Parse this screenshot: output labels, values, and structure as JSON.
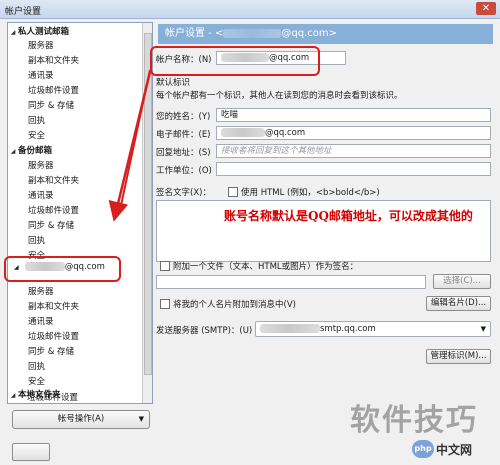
{
  "window": {
    "title": "帐户设置",
    "close_glyph": "✕"
  },
  "tree": {
    "group1": "私人测试邮箱",
    "group1_items": [
      "服务器",
      "副本和文件夹",
      "通讯录",
      "垃圾邮件设置",
      "同步 & 存储",
      "回执",
      "安全"
    ],
    "group2": "备份邮箱",
    "group2_items": [
      "服务器",
      "副本和文件夹",
      "通讯录",
      "垃圾邮件设置",
      "同步 & 存储",
      "回执",
      "安全"
    ],
    "selected_account_suffix": "@qq.com",
    "account_items": [
      "服务器",
      "副本和文件夹",
      "通讯录",
      "垃圾邮件设置",
      "同步 & 存储",
      "回执",
      "安全"
    ],
    "local_group": "本地文件夹",
    "local_items": [
      "垃圾邮件设置"
    ]
  },
  "account_ops_label": "帐号操作(A)",
  "header": {
    "prefix": "帐户设置 - <",
    "suffix": "@qq.com>"
  },
  "account_name": {
    "label": "帐户名称：(N)",
    "suffix": "@qq.com"
  },
  "identity": {
    "title": "默认标识",
    "description": "每个帐户都有一个标识，其他人在读到您的消息时会看到该标识。",
    "name_label": "您的姓名：(Y)",
    "name_value": "吃喵",
    "email_label": "电子邮件：(E)",
    "email_suffix": "@qq.com",
    "reply_label": "回复地址：(S)",
    "reply_placeholder": "接收者将回复到这个其他地址",
    "org_label": "工作单位：(O)",
    "signature_label": "签名文字(X)：",
    "use_html_label": "使用 HTML (例如，<b>bold</b>)"
  },
  "annotation": "账号名称默认是QQ邮箱地址，可以改成其他的",
  "attach": {
    "label": "附加一个文件（文本、HTML或图片）作为签名：",
    "choose_button": "选择(C)..."
  },
  "vcard": {
    "label": "将我的个人名片附加到消息中(V)",
    "edit_button": "编辑名片(D)..."
  },
  "smtp": {
    "label": "发送服务器 (SMTP)：(U)",
    "value_suffix": "smtp.qq.com"
  },
  "manage_identities_button": "管理标识(M)...",
  "watermark": {
    "text": "软件技巧",
    "logo": "php",
    "site": "中文网"
  },
  "colors": {
    "accent": "#87b0d8",
    "highlight": "#d81f1f",
    "annotation": "#d10000"
  }
}
